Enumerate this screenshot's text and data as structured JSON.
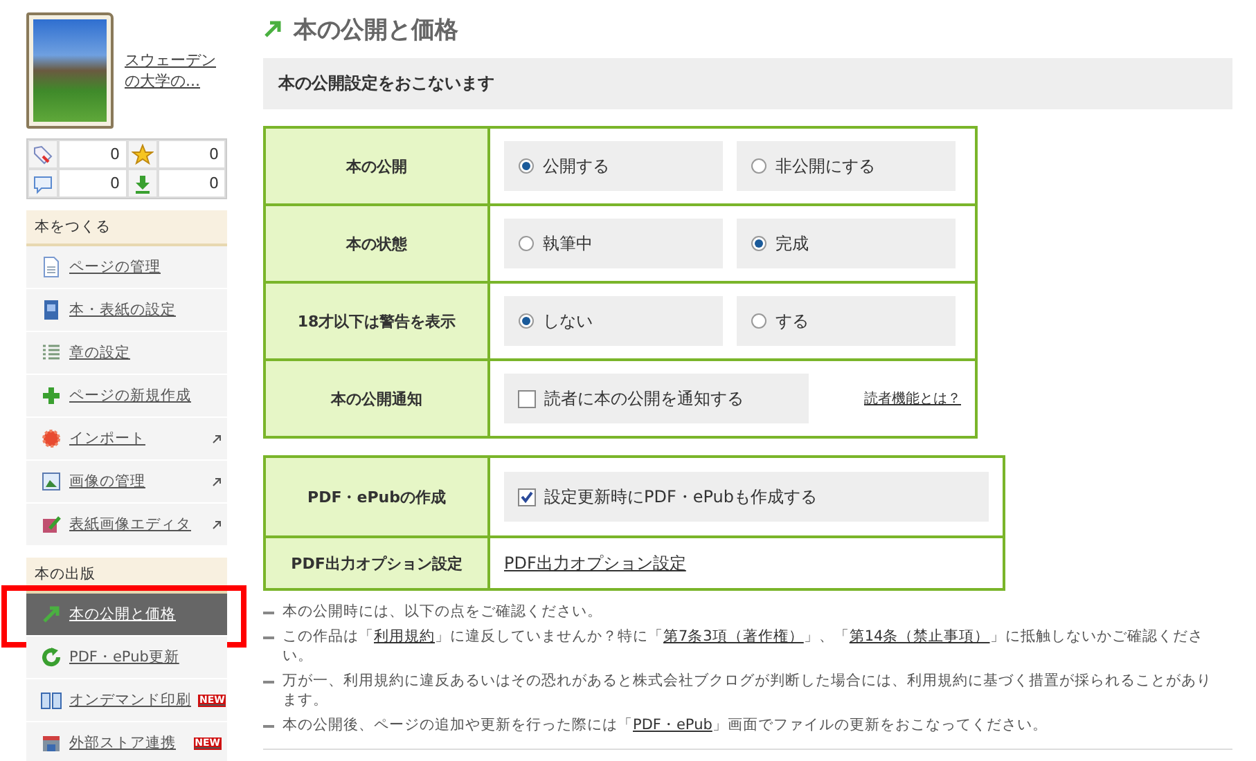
{
  "sidebar": {
    "book": {
      "title": "スウェーデンの大学の..."
    },
    "stats": [
      {
        "value": "0"
      },
      {
        "value": "0"
      },
      {
        "value": "0"
      },
      {
        "value": "0"
      }
    ],
    "sections": [
      {
        "title": "本をつくる",
        "items": [
          {
            "label": "ページの管理",
            "selected": false,
            "external": false
          },
          {
            "label": "本・表紙の設定",
            "selected": false,
            "external": false
          },
          {
            "label": "章の設定",
            "selected": false,
            "external": false
          },
          {
            "label": "ページの新規作成",
            "selected": false,
            "external": false
          },
          {
            "label": "インポート",
            "selected": false,
            "external": true
          },
          {
            "label": "画像の管理",
            "selected": false,
            "external": true
          },
          {
            "label": "表紙画像エディタ",
            "selected": false,
            "external": true
          }
        ]
      },
      {
        "title": "本の出版",
        "items": [
          {
            "label": "本の公開と価格",
            "selected": true,
            "external": false,
            "annotated": true
          },
          {
            "label": "PDF・ePub更新",
            "selected": false,
            "external": false
          },
          {
            "label": "オンデマンド印刷",
            "selected": false,
            "external": false,
            "badge": "NEW"
          },
          {
            "label": "外部ストア連携",
            "selected": false,
            "external": false,
            "badge": "NEW"
          }
        ]
      }
    ]
  },
  "main": {
    "title": "本の公開と価格",
    "subtitle": "本の公開設定をおこないます",
    "tables": [
      {
        "rows": [
          {
            "label": "本の公開",
            "kind": "radio",
            "options": [
              {
                "label": "公開する",
                "selected": true
              },
              {
                "label": "非公開にする",
                "selected": false
              }
            ]
          },
          {
            "label": "本の状態",
            "kind": "radio",
            "options": [
              {
                "label": "執筆中",
                "selected": false
              },
              {
                "label": "完成",
                "selected": true
              }
            ]
          },
          {
            "label": "18才以下は警告を表示",
            "kind": "radio",
            "options": [
              {
                "label": "しない",
                "selected": true
              },
              {
                "label": "する",
                "selected": false
              }
            ]
          },
          {
            "label": "本の公開通知",
            "kind": "checkbox",
            "checkbox": {
              "label": "読者に本の公開を通知する",
              "checked": false
            },
            "link": "読者機能とは？"
          }
        ]
      },
      {
        "rows": [
          {
            "label": "PDF・ePubの作成",
            "kind": "checkbox",
            "checkbox": {
              "label": "設定更新時にPDF・ePubも作成する",
              "checked": true
            }
          },
          {
            "label": "PDF出力オプション設定",
            "kind": "link",
            "link": "PDF出力オプション設定"
          }
        ]
      }
    ],
    "notes": [
      [
        {
          "kind": "text",
          "text": "本の公開時には、以下の点をご確認ください。"
        }
      ],
      [
        {
          "kind": "text",
          "text": "この作品は「"
        },
        {
          "kind": "link",
          "text": "利用規約"
        },
        {
          "kind": "text",
          "text": "」に違反していませんか？特に「"
        },
        {
          "kind": "link",
          "text": "第7条3項（著作権）"
        },
        {
          "kind": "text",
          "text": "」、「"
        },
        {
          "kind": "link",
          "text": "第14条（禁止事項）"
        },
        {
          "kind": "text",
          "text": "」に抵触しないかご確認ください。"
        }
      ],
      [
        {
          "kind": "text",
          "text": "万が一、利用規約に違反あるいはその恐れがあると株式会社ブクログが判断した場合には、利用規約に基づく措置が採られることがあります。"
        }
      ],
      [
        {
          "kind": "text",
          "text": "本の公開後、ページの追加や更新を行った際には「"
        },
        {
          "kind": "link",
          "text": "PDF・ePub"
        },
        {
          "kind": "text",
          "text": "」画面でファイルの更新をおこなってください。"
        }
      ]
    ]
  }
}
